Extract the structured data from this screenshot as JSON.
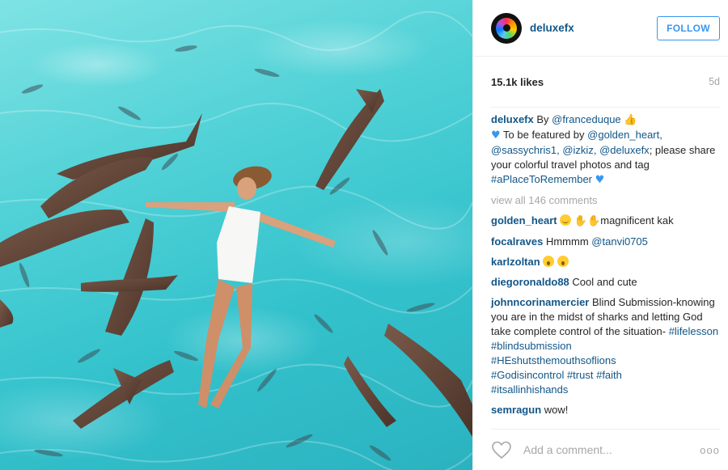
{
  "post": {
    "image_alt": "",
    "author": "deluxefx",
    "follow_label": "FOLLOW",
    "likes": "15.1k likes",
    "age": "5d",
    "caption": {
      "user": "deluxefx",
      "by": "By",
      "mention_photographer": "@franceduque",
      "line2_prefix": "To be featured by",
      "mention_golden": "@golden_heart,",
      "mention_sassy": "@sassychris1,",
      "mention_izkiz": "@izkiz,",
      "mention_deluxe": "@deluxefx",
      "line_rest": "; please share your colorful travel photos and tag",
      "hashtag": "#aPlaceToRemember"
    },
    "view_all": "view all 146 comments",
    "comments": [
      {
        "user": "golden_heart",
        "text": "magnificent kak"
      },
      {
        "user": "focalraves",
        "text": "Hmmmm",
        "mention": "@tanvi0705"
      },
      {
        "user": "karlzoltan",
        "text": ""
      },
      {
        "user": "diegoronaldo88",
        "text": "Cool and cute"
      },
      {
        "user": "johnncorinamercier",
        "text": "Blind Submission-knowing you are in the midst of sharks and letting God take complete control of the situation-",
        "tags": [
          "#lifelesson",
          "#blindsubmission",
          "#HEshutsthemouthsoflions",
          "#Godisincontrol",
          "#trust",
          "#faith",
          "#itsallinhishands"
        ]
      },
      {
        "user": "semragun",
        "text": "wow!"
      }
    ],
    "add_comment_placeholder": "Add a comment...",
    "more_label": "ooo"
  },
  "colors": {
    "link": "#125688",
    "accent": "#3897f0",
    "muted": "#a5a7aa",
    "water": "#4fd1d6"
  },
  "icons": {
    "like": "heart-outline-icon",
    "more": "more-dots-icon"
  }
}
